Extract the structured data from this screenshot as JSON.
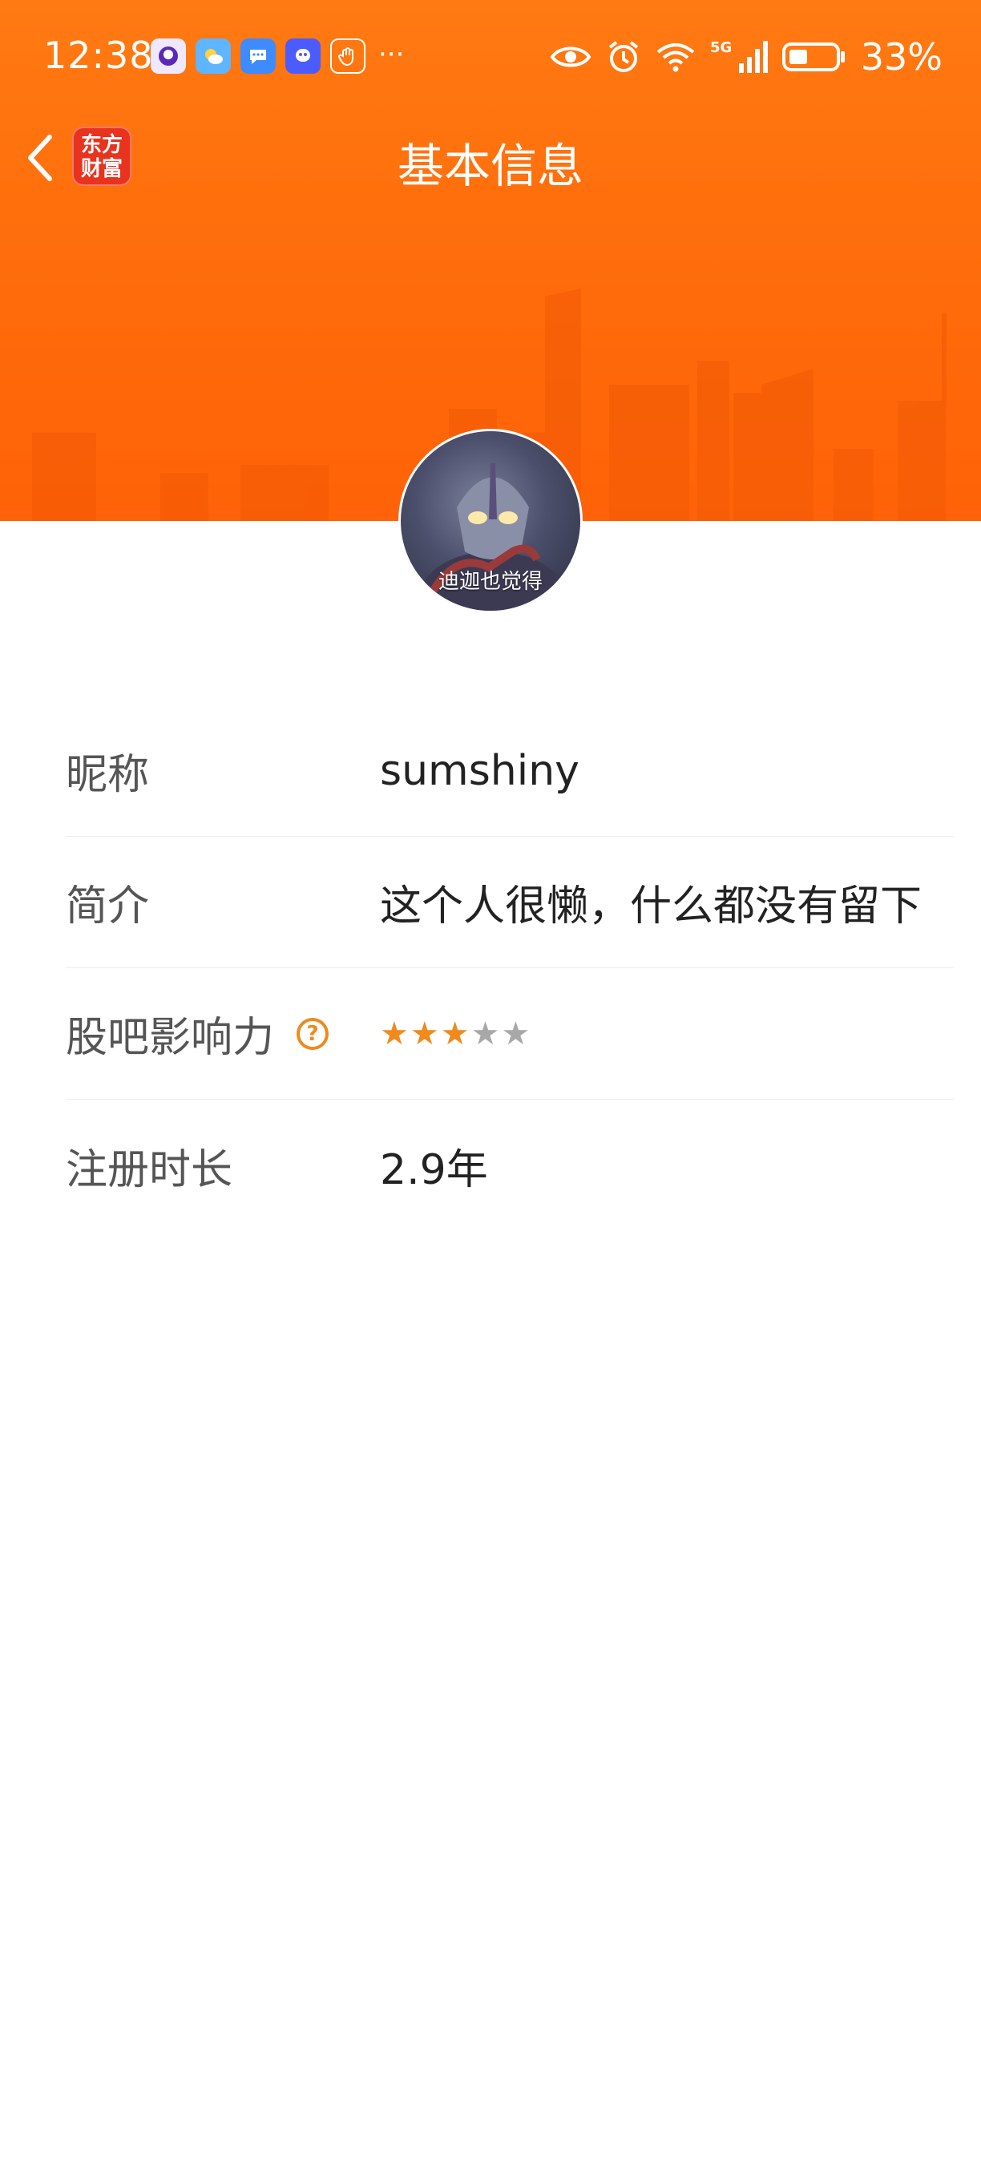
{
  "status_bar": {
    "time": "12:38",
    "network": "5G",
    "battery": "33%",
    "notification_icons": [
      "app-icon-1",
      "weather-icon",
      "message-icon",
      "qq-icon",
      "hand-icon"
    ],
    "more": "···"
  },
  "nav": {
    "title": "基本信息",
    "app_logo_line1": "东方",
    "app_logo_line2": "财富"
  },
  "avatar": {
    "caption": "迪迦也觉得"
  },
  "info": {
    "nickname_label": "昵称",
    "nickname_value": "sumshiny",
    "bio_label": "简介",
    "bio_value": "这个人很懒，什么都没有留下",
    "influence_label": "股吧影响力",
    "influence_stars_filled": 3,
    "influence_stars_total": 5,
    "reg_label": "注册时长",
    "reg_value": "2.9年"
  },
  "colors": {
    "header_orange": "#ff6a0a",
    "star_filled": "#f08a1c",
    "star_empty": "#a8a8a8",
    "help_icon": "#ee8a1e"
  }
}
